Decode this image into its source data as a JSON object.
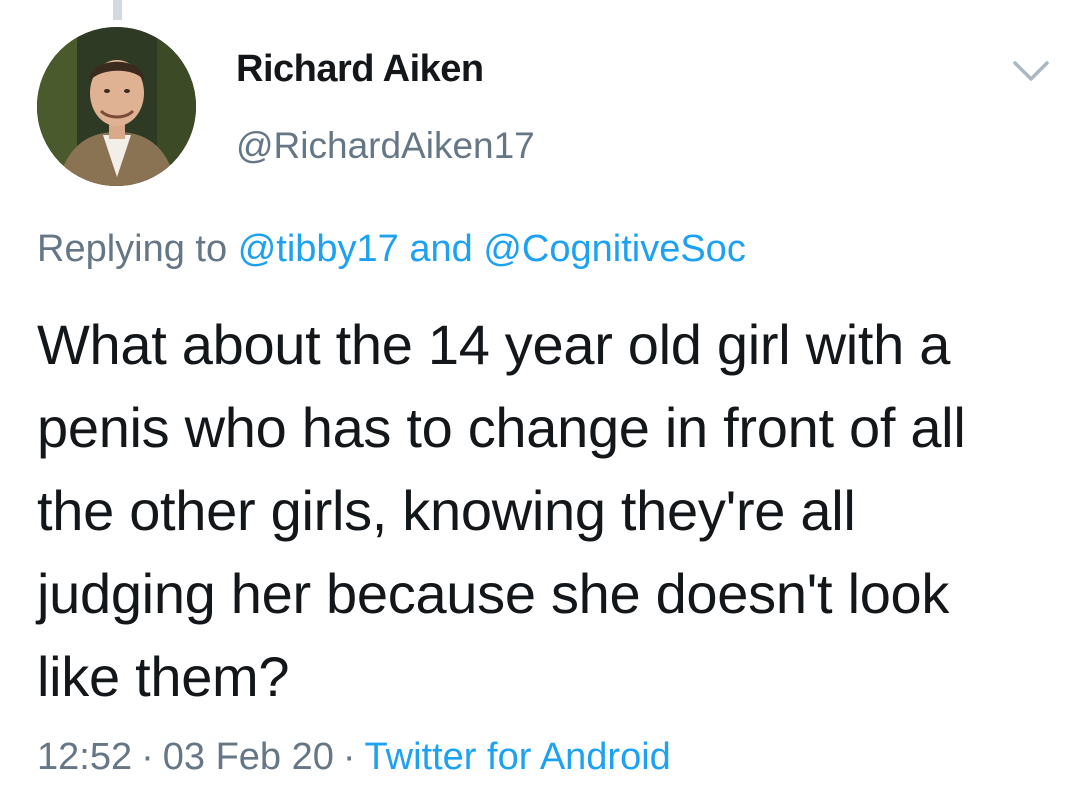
{
  "tweet": {
    "author": {
      "display_name": "Richard Aiken",
      "handle": "@RichardAiken17"
    },
    "menu_icon": "chevron-down-icon",
    "reply_context": {
      "prefix": "Replying to",
      "mention_1": "@tibby17",
      "conjunction": "and",
      "mention_2": "@CognitiveSoc"
    },
    "text": "What about the 14 year old girl with a penis who has to change in front of all the other girls, knowing they're all judging her because she doesn't look like them?",
    "time": "12:52",
    "separator": "·",
    "date": "03 Feb 20",
    "source": "Twitter for Android"
  },
  "colors": {
    "text_primary": "#14171a",
    "text_secondary": "#657786",
    "link": "#1da1f2",
    "thread_line": "#d3d9de"
  }
}
